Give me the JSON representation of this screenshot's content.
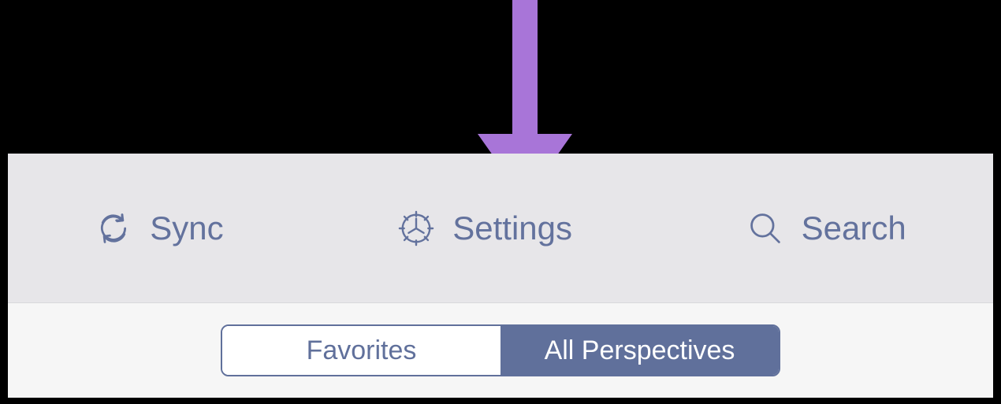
{
  "annotation": {
    "arrow_color": "#a875d8"
  },
  "toolbar": {
    "icon_color": "#63729d",
    "items": [
      {
        "label": "Sync",
        "icon": "sync-icon"
      },
      {
        "label": "Settings",
        "icon": "gear-icon"
      },
      {
        "label": "Search",
        "icon": "search-icon"
      }
    ]
  },
  "tabs": {
    "segments": [
      {
        "label": "Favorites",
        "active": false
      },
      {
        "label": "All Perspectives",
        "active": true
      }
    ]
  }
}
